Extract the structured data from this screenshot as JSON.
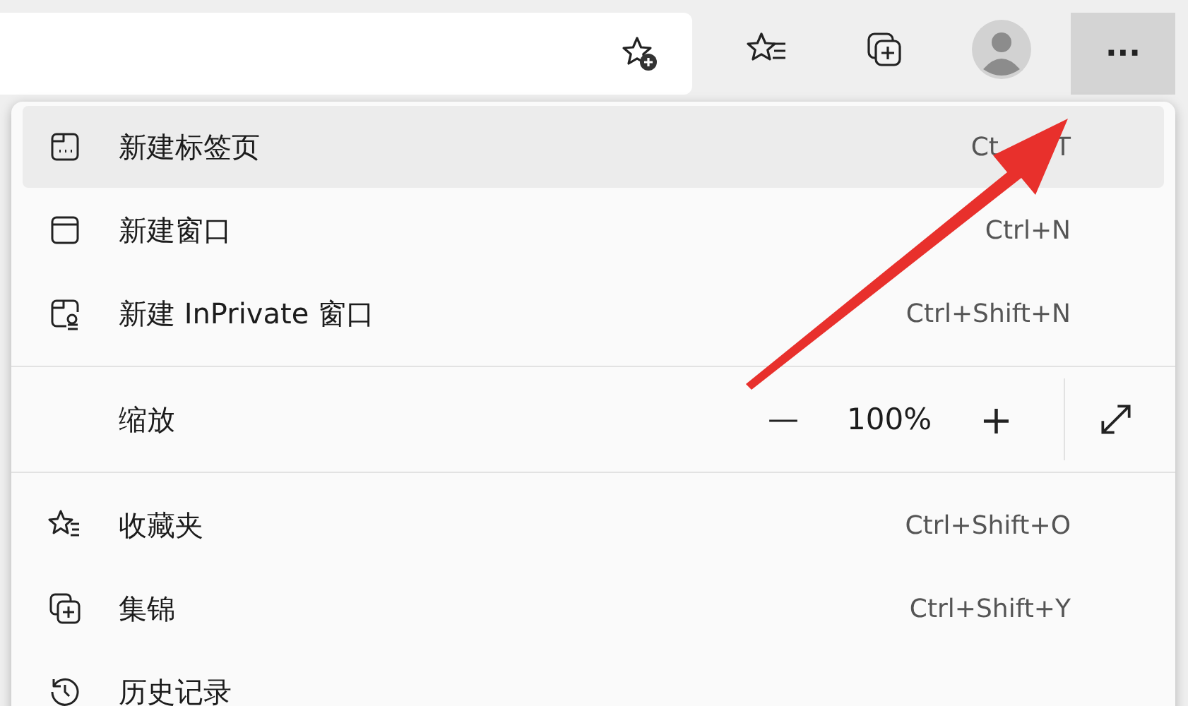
{
  "toolbar": {
    "more_button": {
      "label": "···",
      "selected": true
    }
  },
  "menu": {
    "sections": [
      [
        {
          "kind": "item",
          "label": "新建标签页",
          "shortcut": "Ct",
          "shortcut_tail": "T",
          "selected": true
        },
        {
          "kind": "item",
          "label": "新建窗口",
          "shortcut": "Ctrl+N",
          "selected": false
        },
        {
          "kind": "item",
          "label": "新建 InPrivate 窗口",
          "shortcut": "Ctrl+Shift+N",
          "selected": false
        }
      ],
      [
        {
          "kind": "zoom",
          "label": "缩放",
          "minus": "—",
          "value": "100%",
          "plus": "+"
        }
      ],
      [
        {
          "kind": "item",
          "label": "收藏夹",
          "shortcut": "Ctrl+Shift+O",
          "selected": false
        },
        {
          "kind": "item",
          "label": "集锦",
          "shortcut": "Ctrl+Shift+Y",
          "selected": false
        },
        {
          "kind": "item",
          "label": "历史记录",
          "selected": false
        }
      ]
    ]
  }
}
